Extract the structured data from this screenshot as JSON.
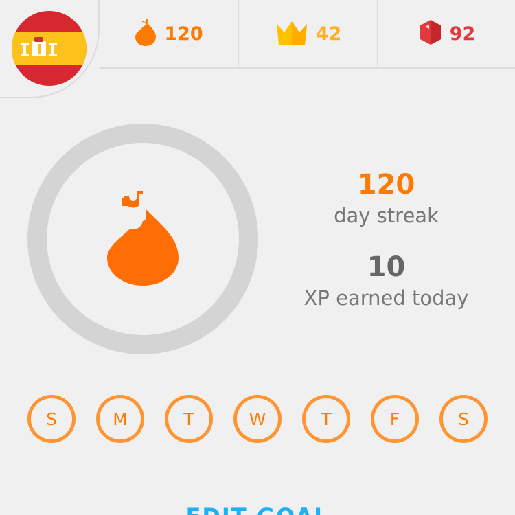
{
  "header": {
    "course_flag": {
      "icon": "spain-flag-icon",
      "colors": {
        "red": "#d7282f",
        "yellow": "#fcc21b"
      }
    },
    "streak": {
      "icon": "flame-icon",
      "value": "120",
      "color": "#ff7a00"
    },
    "crowns": {
      "icon": "crown-icon",
      "value": "42",
      "color": "#ffb020"
    },
    "gems": {
      "icon": "gem-icon",
      "value": "92",
      "color": "#e0393e"
    }
  },
  "streak_panel": {
    "icon": "flame-icon",
    "streak_days": "120",
    "streak_label": "day streak",
    "xp_today": "10",
    "xp_label": "XP earned today"
  },
  "week": {
    "days": [
      "S",
      "M",
      "T",
      "W",
      "T",
      "F",
      "S"
    ]
  },
  "footer": {
    "edit_goal_label": "EDIT GOAL"
  }
}
